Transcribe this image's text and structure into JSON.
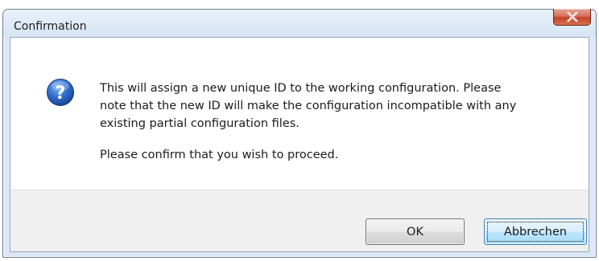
{
  "window": {
    "title": "Confirmation"
  },
  "title_bar": {
    "close_icon": "close-icon"
  },
  "message": {
    "icon": "question-icon",
    "line1": "This will assign a new unique ID to the working configuration. Please",
    "line2": "note that the new ID will make the configuration incompatible with any",
    "line3": "existing partial configuration files.",
    "confirm": "Please confirm that you wish to proceed."
  },
  "buttons": {
    "ok_label": "OK",
    "cancel_label": "Abbrechen"
  },
  "colors": {
    "frame": "#dce8f5",
    "close_button": "#c1432a",
    "icon_blue": "#1f5bb8",
    "default_button": "#a7d9f5"
  }
}
